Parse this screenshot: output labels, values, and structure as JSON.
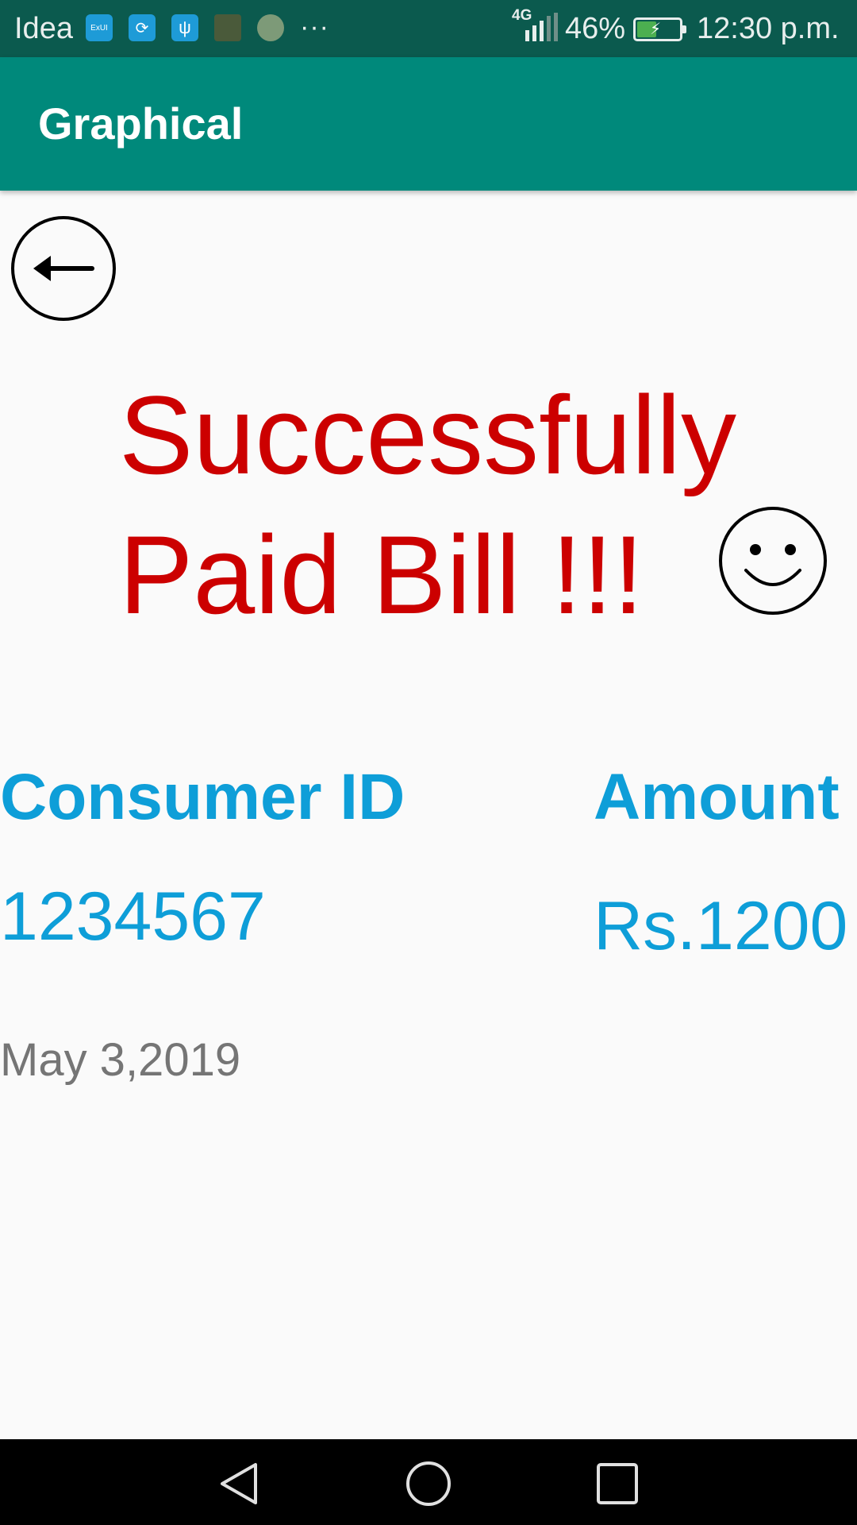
{
  "status_bar": {
    "carrier": "Idea",
    "notification_icons": [
      "exui-icon",
      "sync-icon",
      "usb-icon",
      "photo-icon",
      "avatar-icon"
    ],
    "more": "···",
    "network_type": "4G",
    "battery_percent": "46%",
    "battery_level": 0.46,
    "time": "12:30 p.m.",
    "colors": {
      "background": "#0b5a4e",
      "battery_fill": "#4caf50"
    }
  },
  "app_bar": {
    "title": "Graphical",
    "color": "#00897b"
  },
  "main": {
    "back_icon": "back-arrow-icon",
    "success_line1": "Successfully",
    "success_line2": "Paid Bill !!!",
    "smiley_icon": "smiley-icon",
    "consumer_id_label": "Consumer ID",
    "amount_label": "Amount",
    "consumer_id_value": "1234567",
    "amount_value": "Rs.1200",
    "date": "May 3,2019",
    "colors": {
      "success": "#cc0000",
      "accent": "#0e9ed8",
      "date": "#757575"
    }
  },
  "nav_bar": {
    "buttons": [
      "back-triangle-icon",
      "home-circle-icon",
      "recents-square-icon"
    ]
  }
}
